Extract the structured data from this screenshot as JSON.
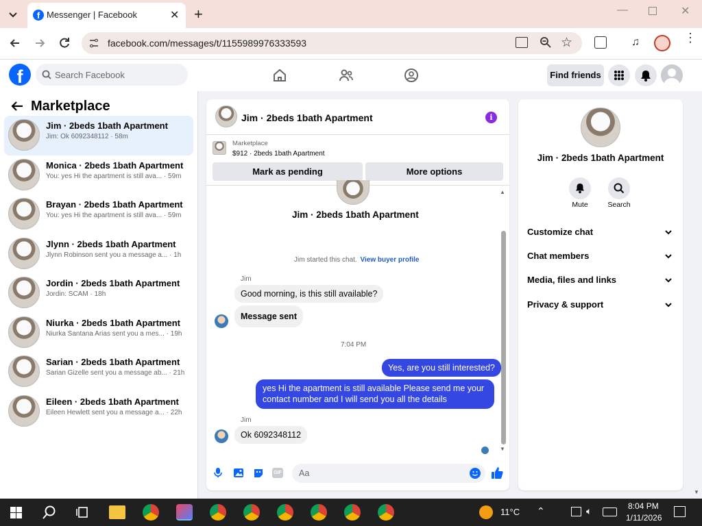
{
  "browser": {
    "tab_title": "Messenger | Facebook",
    "url": "facebook.com/messages/t/1155989976333593"
  },
  "fb": {
    "search_placeholder": "Search Facebook",
    "find_friends": "Find friends"
  },
  "sidebar": {
    "title": "Marketplace",
    "conversations": [
      {
        "name": "Jim · 2beds 1bath Apartment",
        "preview": "Jim: Ok 6092348112 · 58m"
      },
      {
        "name": "Monica · 2beds 1bath Apartment",
        "preview": "You: yes Hi the apartment is still ava... · 59m"
      },
      {
        "name": "Brayan · 2beds 1bath Apartment",
        "preview": "You: yes Hi the apartment is still ava... · 59m"
      },
      {
        "name": "Jlynn · 2beds 1bath Apartment",
        "preview": "Jlynn Robinson sent you a message a... · 1h"
      },
      {
        "name": "Jordin · 2beds 1bath Apartment",
        "preview": "Jordin: SCAM · 18h"
      },
      {
        "name": "Niurka · 2beds 1bath Apartment",
        "preview": "Niurka Santana Arias sent you a mes... · 19h"
      },
      {
        "name": "Sarian · 2beds 1bath Apartment",
        "preview": "Sarian Gizelle sent you a message ab... · 21h"
      },
      {
        "name": "Eileen · 2beds 1bath Apartment",
        "preview": "Eileen Hewlett sent you a message a... · 22h"
      }
    ]
  },
  "chat": {
    "header_title": "Jim · 2beds 1bath Apartment",
    "listing_label": "Marketplace",
    "listing_detail": "$912 · 2beds 1bath Apartment",
    "mark_pending": "Mark as pending",
    "more_options": "More options",
    "profile_name": "Jim · 2beds 1bath Apartment",
    "started_text": "Jim started this chat.",
    "view_profile": "View buyer profile",
    "sender1": "Jim",
    "msg1": "Good morning, is this still available?",
    "msg2": "Message sent",
    "time": "7:04 PM",
    "msg3": "Yes, are you still interested?",
    "msg4_line1": "yes Hi the apartment is still available Please send me your",
    "msg4_line2": "contact number and I will send you all the details",
    "sender2": "Jim",
    "msg5": "Ok 6092348112",
    "composer_placeholder": "Aa"
  },
  "details": {
    "name": "Jim · 2beds 1bath Apartment",
    "mute": "Mute",
    "search": "Search",
    "sections": [
      "Customize chat",
      "Chat members",
      "Media, files and links",
      "Privacy & support"
    ]
  },
  "taskbar": {
    "temp": "11°C",
    "time": "8:04 PM",
    "date": "1/11/2026"
  },
  "colors": {
    "accent": "#3447e3",
    "fb_blue": "#0866ff",
    "link": "#1f5bc4"
  }
}
